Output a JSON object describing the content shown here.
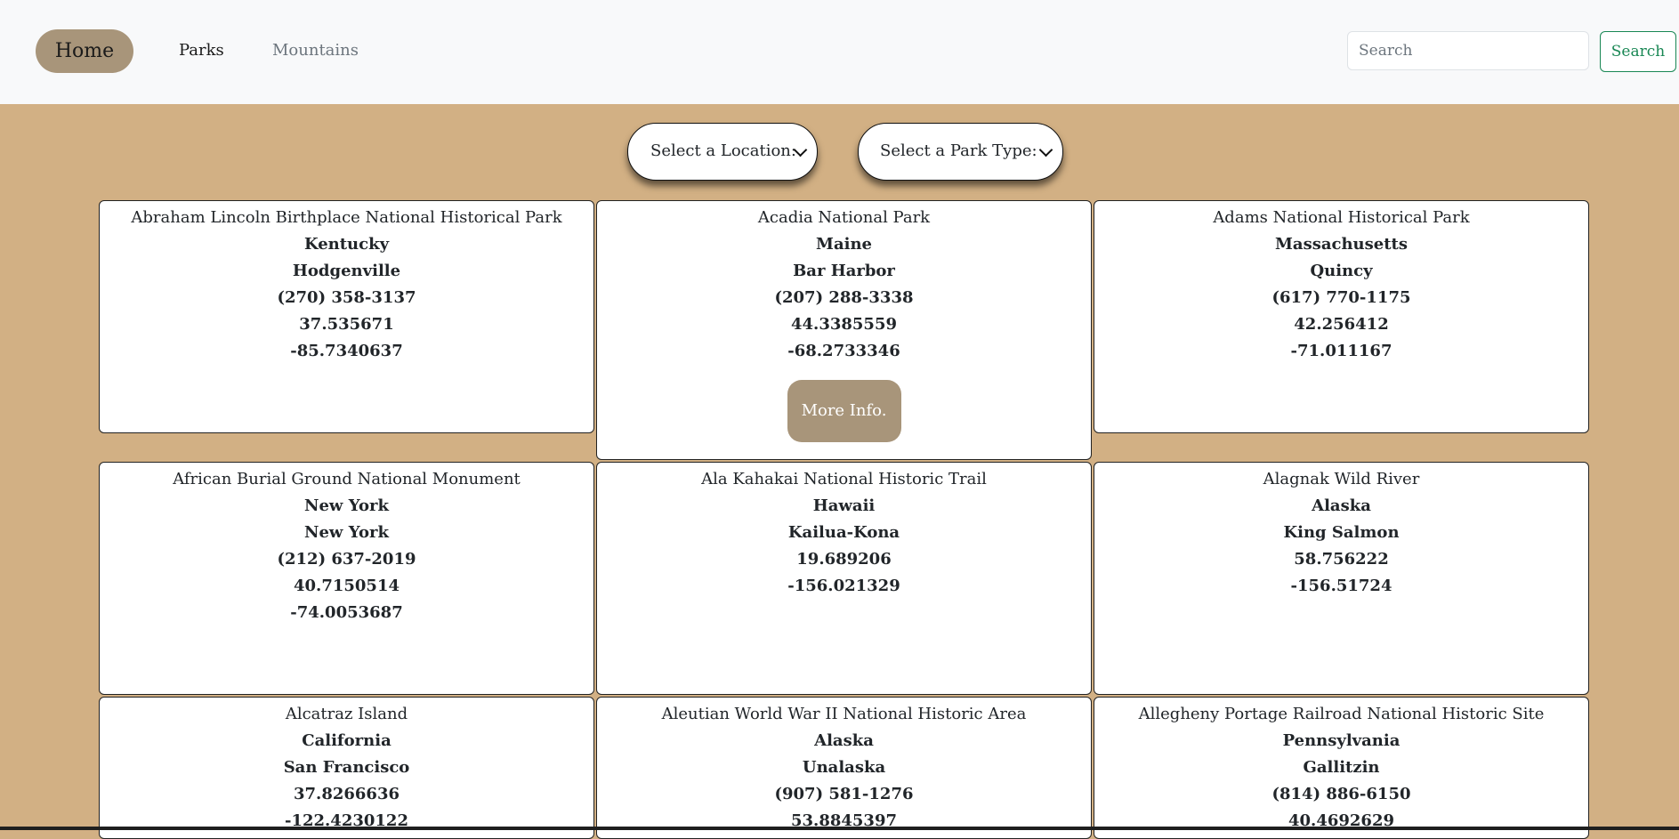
{
  "nav": {
    "home": "Home",
    "parks": "Parks",
    "mountains": "Mountains",
    "search_placeholder": "Search",
    "search_button": "Search"
  },
  "filters": {
    "location": "Select a Location:",
    "park_type": "Select a Park Type:"
  },
  "colors": {
    "background": "#d2b084",
    "accent": "#a8957a",
    "search_green": "#198754"
  },
  "parks": [
    {
      "name": "Abraham Lincoln Birthplace National Historical Park",
      "state": "Kentucky",
      "city": "Hodgenville",
      "phone": "(270) 358-3137",
      "lat": "37.535671",
      "lon": "-85.7340637"
    },
    {
      "name": "Acadia National Park",
      "state": "Maine",
      "city": "Bar Harbor",
      "phone": "(207) 288-3338",
      "lat": "44.3385559",
      "lon": "-68.2733346",
      "button": "More Info."
    },
    {
      "name": "Adams National Historical Park",
      "state": "Massachusetts",
      "city": "Quincy",
      "phone": "(617) 770-1175",
      "lat": "42.256412",
      "lon": "-71.011167"
    },
    {
      "name": "African Burial Ground National Monument",
      "state": "New York",
      "city": "New York",
      "phone": "(212) 637-2019",
      "lat": "40.7150514",
      "lon": "-74.0053687"
    },
    {
      "name": "Ala Kahakai National Historic Trail",
      "state": "Hawaii",
      "city": "Kailua-Kona",
      "lat": "19.689206",
      "lon": "-156.021329"
    },
    {
      "name": "Alagnak Wild River",
      "state": "Alaska",
      "city": "King Salmon",
      "lat": "58.756222",
      "lon": "-156.51724"
    },
    {
      "name": "Alcatraz Island",
      "state": "California",
      "city": "San Francisco",
      "lat": "37.8266636",
      "lon": "-122.4230122"
    },
    {
      "name": "Aleutian World War II National Historic Area",
      "state": "Alaska",
      "city": "Unalaska",
      "phone": "(907) 581-1276",
      "lat": "53.8845397"
    },
    {
      "name": "Allegheny Portage Railroad National Historic Site",
      "state": "Pennsylvania",
      "city": "Gallitzin",
      "phone": "(814) 886-6150",
      "lat": "40.4692629"
    }
  ]
}
